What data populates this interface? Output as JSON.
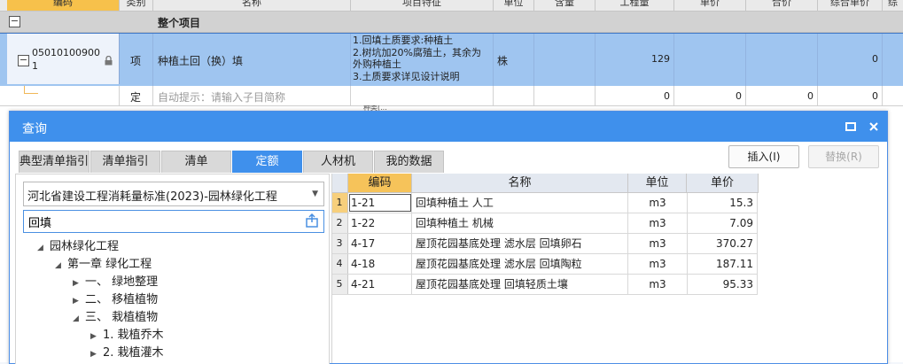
{
  "sheet": {
    "headers": [
      "编码",
      "类别",
      "名称",
      "项目特征",
      "单位",
      "含量",
      "工程量",
      "单价",
      "合价",
      "综合单价",
      "综"
    ],
    "whole_project_label": "整个项目",
    "item": {
      "code_line1": "05010100900",
      "code_line2": "1",
      "category": "项",
      "name": "种植土回（换）填",
      "features": [
        "1.回填土质要求:种植土",
        "2.树坑加20%腐殖土，其余为",
        "外购种植土",
        "3.土质要求详见设计说明"
      ],
      "unit": "株",
      "quantity": "129",
      "total_unit_price": "0"
    },
    "sub": {
      "category": "定",
      "name_hint": "自动提示：请输入子目简称",
      "quantity": "0",
      "unit_price": "0",
      "total": "0",
      "total_unit_price": "0"
    },
    "peek_text": "种类(..."
  },
  "dialog": {
    "title": "查询",
    "maximize_icon": "maximize-icon",
    "close_icon": "close-icon",
    "tabs": [
      "典型清单指引",
      "清单指引",
      "清单",
      "定额",
      "人材机",
      "我的数据"
    ],
    "active_tab": "定额",
    "insert_button": "插入(I)",
    "replace_button": "替换(R)",
    "library": "河北省建设工程消耗量标准(2023)-园林绿化工程",
    "search_value": "回填",
    "tree": [
      {
        "label": "园林绿化工程",
        "level": 0,
        "state": "expanded"
      },
      {
        "label": "第一章 绿化工程",
        "level": 1,
        "state": "expanded"
      },
      {
        "label": "一、 绿地整理",
        "level": 2,
        "state": "collapsed"
      },
      {
        "label": "二、 移植植物",
        "level": 2,
        "state": "collapsed"
      },
      {
        "label": "三、 栽植植物",
        "level": 2,
        "state": "expanded"
      },
      {
        "label": "1. 栽植乔木",
        "level": 3,
        "state": "collapsed"
      },
      {
        "label": "2. 栽植灌木",
        "level": 3,
        "state": "collapsed"
      }
    ],
    "table": {
      "columns": [
        "编码",
        "名称",
        "单位",
        "单价"
      ],
      "rows": [
        {
          "idx": "1",
          "code": "1-21",
          "name": "回填种植土 人工",
          "unit": "m3",
          "price": "15.3"
        },
        {
          "idx": "2",
          "code": "1-22",
          "name": "回填种植土 机械",
          "unit": "m3",
          "price": "7.09"
        },
        {
          "idx": "3",
          "code": "4-17",
          "name": "屋顶花园基底处理 滤水层 回填卵石",
          "unit": "m3",
          "price": "370.27"
        },
        {
          "idx": "4",
          "code": "4-18",
          "name": "屋顶花园基底处理 滤水层 回填陶粒",
          "unit": "m3",
          "price": "187.11"
        },
        {
          "idx": "5",
          "code": "4-21",
          "name": "屋顶花园基底处理 回填轻质土壤",
          "unit": "m3",
          "price": "95.33"
        }
      ]
    }
  }
}
